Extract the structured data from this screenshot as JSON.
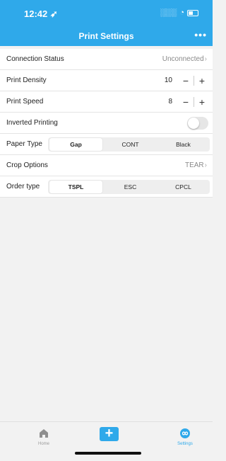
{
  "status_bar": {
    "time": "12:42",
    "signal": "░░░",
    "wifi": "◔"
  },
  "nav": {
    "title": "Print Settings",
    "more": "•••"
  },
  "rows": {
    "connection": {
      "label": "Connection Status",
      "value": "Unconnected"
    },
    "density": {
      "label": "Print Density",
      "value": "10"
    },
    "speed": {
      "label": "Print Speed",
      "value": "8"
    },
    "inverted": {
      "label": "Inverted Printing",
      "on": false
    },
    "paper": {
      "label": "Paper Type",
      "options": [
        "Gap",
        "CONT",
        "Black"
      ],
      "selected": "Gap"
    },
    "crop": {
      "label": "Crop Options",
      "value": "TEAR"
    },
    "order": {
      "label": "Order type",
      "options": [
        "TSPL",
        "ESC",
        "CPCL"
      ],
      "selected": "TSPL"
    }
  },
  "stepper": {
    "minus": "−",
    "plus": "+"
  },
  "tabbar": {
    "home": {
      "label": "Home",
      "icon": "home-icon"
    },
    "add": {
      "label": "+",
      "icon": "plus-icon"
    },
    "settings": {
      "label": "Settings",
      "icon": "settings-icon"
    }
  },
  "colors": {
    "accent": "#2fa9ea"
  }
}
